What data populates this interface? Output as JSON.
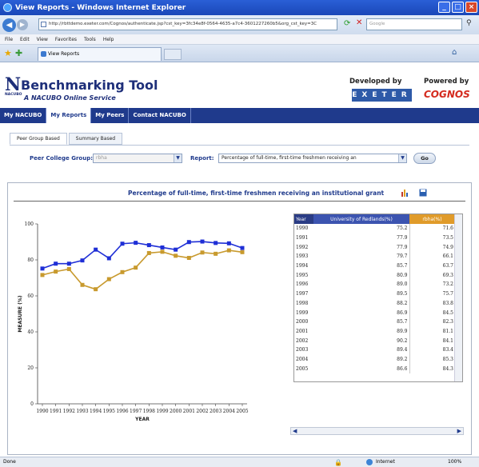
{
  "browser": {
    "window_title": "View Reports - Windows Internet Explorer",
    "address": "http://rbttdemo.exeter.com/Cognos/authenticate.jsp?cst_key=3fc34e8f-0564-4635-a7c4-3601227260b5&org_cst_key=3C",
    "search_placeholder": "Google",
    "menu": [
      "File",
      "Edit",
      "View",
      "Favorites",
      "Tools",
      "Help"
    ],
    "tab_title": "View Reports",
    "status": "Done",
    "zone": "Internet",
    "zoom": "100%"
  },
  "site": {
    "logo_small": "NACUBO",
    "title": "Benchmarking Tool",
    "subtitle": "A NACUBO Online Service",
    "developed_by": "Developed by",
    "exeter": "EXETER",
    "powered_by": "Powered by",
    "cognos": "COGNOS"
  },
  "nav": [
    "My NACUBO",
    "My Reports",
    "My Peers",
    "Contact NACUBO"
  ],
  "subtabs": [
    "Peer Group Based",
    "Summary Based"
  ],
  "filters": {
    "peer_label": "Peer College Group:",
    "peer_value": "rbha",
    "report_label": "Report:",
    "report_value": "Percentage of full-time, first-time freshmen receiving an",
    "go": "Go"
  },
  "report": {
    "title": "Percentage of full-time, first-time freshmen receiving an institutional grant"
  },
  "colors": {
    "series1": "#1f2fd6",
    "series2": "#c89a2e"
  },
  "chart_data": {
    "type": "line",
    "xlabel": "YEAR",
    "ylabel": "MEASURE (%)",
    "ylim": [
      0,
      100
    ],
    "yticks": [
      0,
      20,
      40,
      60,
      80,
      100
    ],
    "x": [
      "1990",
      "1991",
      "1992",
      "1993",
      "1994",
      "1995",
      "1996",
      "1997",
      "1998",
      "1999",
      "2000",
      "2001",
      "2002",
      "2003",
      "2004",
      "2005"
    ],
    "series": [
      {
        "name": "University of Redlands(%)",
        "values": [
          75.2,
          77.9,
          77.9,
          79.7,
          85.7,
          80.9,
          89.0,
          89.5,
          88.2,
          86.9,
          85.7,
          89.9,
          90.2,
          89.4,
          89.2,
          86.6
        ]
      },
      {
        "name": "rbha(%)",
        "values": [
          71.6,
          73.5,
          74.9,
          66.1,
          63.7,
          69.3,
          73.2,
          75.7,
          83.8,
          84.5,
          82.3,
          81.1,
          84.1,
          83.4,
          85.3,
          84.3
        ]
      }
    ]
  },
  "table": {
    "headers": [
      "Year",
      "University of Redlands(%)",
      "rbha(%)"
    ],
    "rows": [
      [
        "1990",
        "75.2",
        "71.6"
      ],
      [
        "1991",
        "77.9",
        "73.5"
      ],
      [
        "1992",
        "77.9",
        "74.9"
      ],
      [
        "1993",
        "79.7",
        "66.1"
      ],
      [
        "1994",
        "85.7",
        "63.7"
      ],
      [
        "1995",
        "80.9",
        "69.3"
      ],
      [
        "1996",
        "89.0",
        "73.2"
      ],
      [
        "1997",
        "89.5",
        "75.7"
      ],
      [
        "1998",
        "88.2",
        "83.8"
      ],
      [
        "1999",
        "86.9",
        "84.5"
      ],
      [
        "2000",
        "85.7",
        "82.3"
      ],
      [
        "2001",
        "89.9",
        "81.1"
      ],
      [
        "2002",
        "90.2",
        "84.1"
      ],
      [
        "2003",
        "89.4",
        "83.4"
      ],
      [
        "2004",
        "89.2",
        "85.3"
      ],
      [
        "2005",
        "86.6",
        "84.3"
      ]
    ]
  }
}
